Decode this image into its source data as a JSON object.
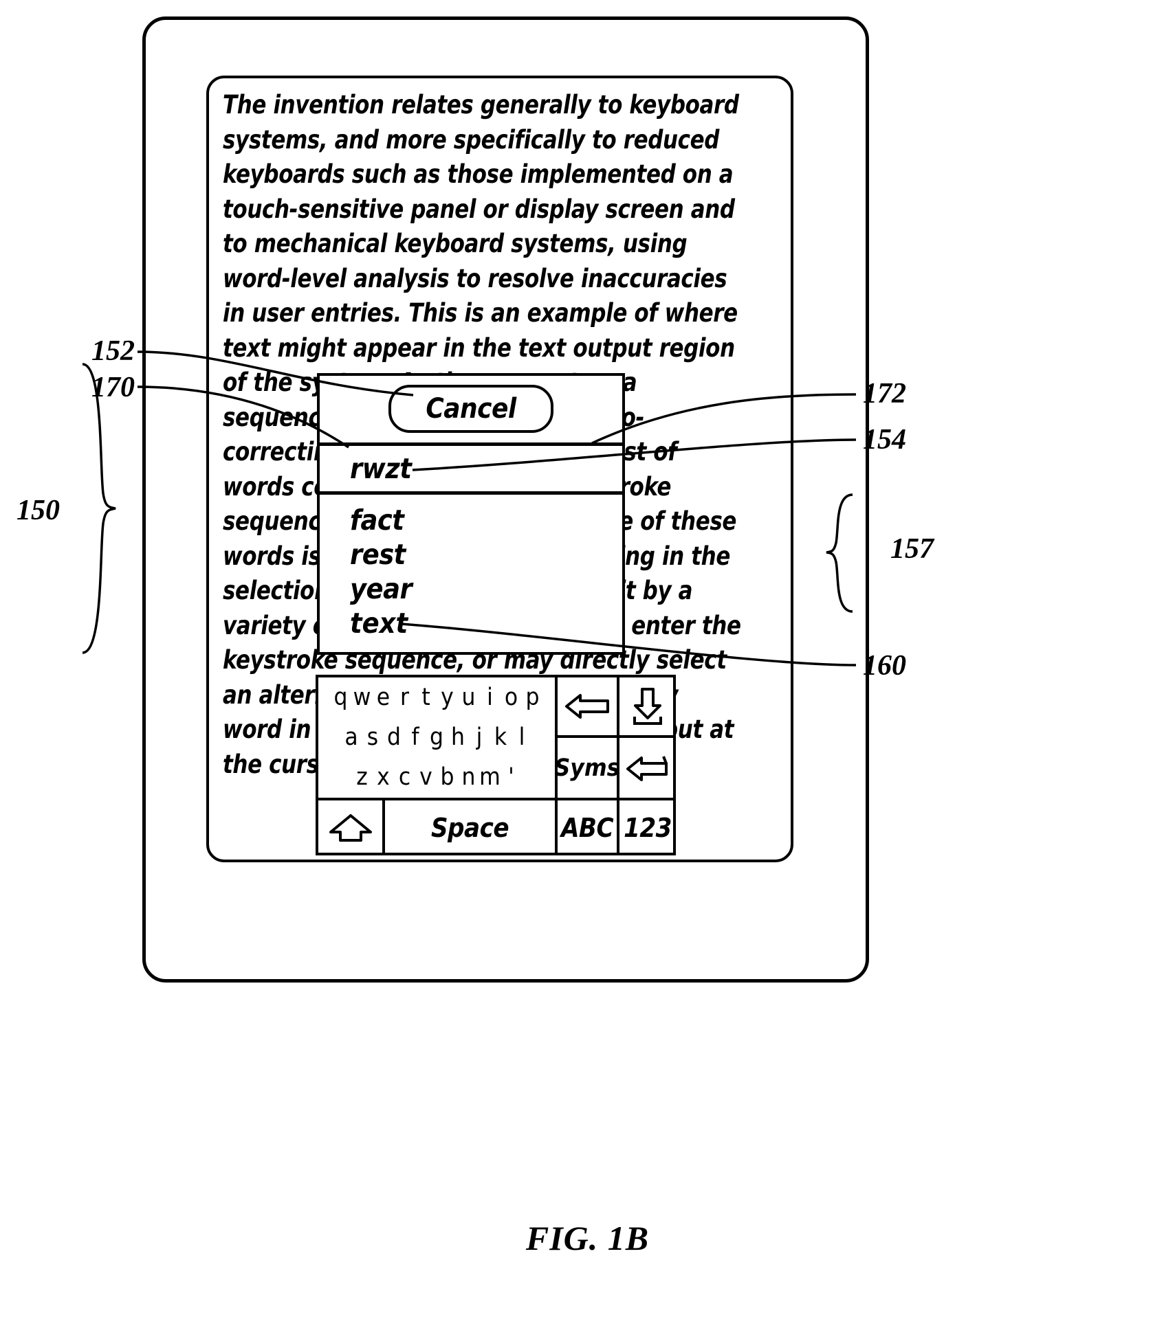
{
  "figure": {
    "caption": "FIG. 1B"
  },
  "text_output_region": {
    "ref": "150",
    "content": "The invention relates generally to keyboard systems, and more specifically to reduced keyboards such as those implemented on a touch-sensitive panel or display screen and to mechanical keyboard systems, using word-level analysis to resolve inaccuracies in user entries. This is an example of where text might appear in the text output region of the system. As the user enters a sequence of keystrokes in the auto-correcting keyboard, a selection list of words corresponding to the keystroke sequence are displayed. When one of these words is the desired word appearing in the selection list, the user can select it by a variety of means, or continuing to enter the keystroke sequence, or may directly select an alternate word in the sequence any word in the selection list which is output at the cursor position in the "
  },
  "popup": {
    "ref": "152",
    "cancel_label": "Cancel",
    "cancel_ref": "170",
    "entry_ref": "172",
    "entry_value": "rwzt",
    "entry_value_ref": "154",
    "word_list_ref": "157",
    "words": [
      {
        "label": "fact",
        "selected": false
      },
      {
        "label": "rest",
        "selected": false
      },
      {
        "label": "year",
        "selected": false
      },
      {
        "label": "text",
        "selected": true
      }
    ]
  },
  "keyboard": {
    "ref": "160",
    "rows": [
      [
        "q",
        "w",
        "e",
        "r",
        "t",
        "y",
        "u",
        "i",
        "o",
        "p"
      ],
      [
        "a",
        "s",
        "d",
        "f",
        "g",
        "h",
        "j",
        "k",
        "l"
      ],
      [
        "z",
        "x",
        "c",
        "v",
        "b",
        "n",
        "m",
        "'"
      ]
    ],
    "function_keys": [
      {
        "name": "backspace-key",
        "icon": "left-arrow-icon",
        "label": ""
      },
      {
        "name": "enter-download-key",
        "icon": "down-arrow-into-tray-icon",
        "label": ""
      },
      {
        "name": "syms-key",
        "icon": "",
        "label": "Syms"
      },
      {
        "name": "return-key",
        "icon": "return-arrow-icon",
        "label": ""
      }
    ],
    "bottom_row": [
      {
        "name": "shift-key",
        "icon": "up-arrow-icon",
        "label": ""
      },
      {
        "name": "space-key",
        "icon": "",
        "label": "Space"
      },
      {
        "name": "abc-key",
        "icon": "",
        "label": "ABC"
      },
      {
        "name": "numeric-key",
        "icon": "",
        "label": "123"
      }
    ]
  },
  "reference_numerals": {
    "n150": "150",
    "n152": "152",
    "n170": "170",
    "n172": "172",
    "n154": "154",
    "n157": "157",
    "n160": "160"
  }
}
